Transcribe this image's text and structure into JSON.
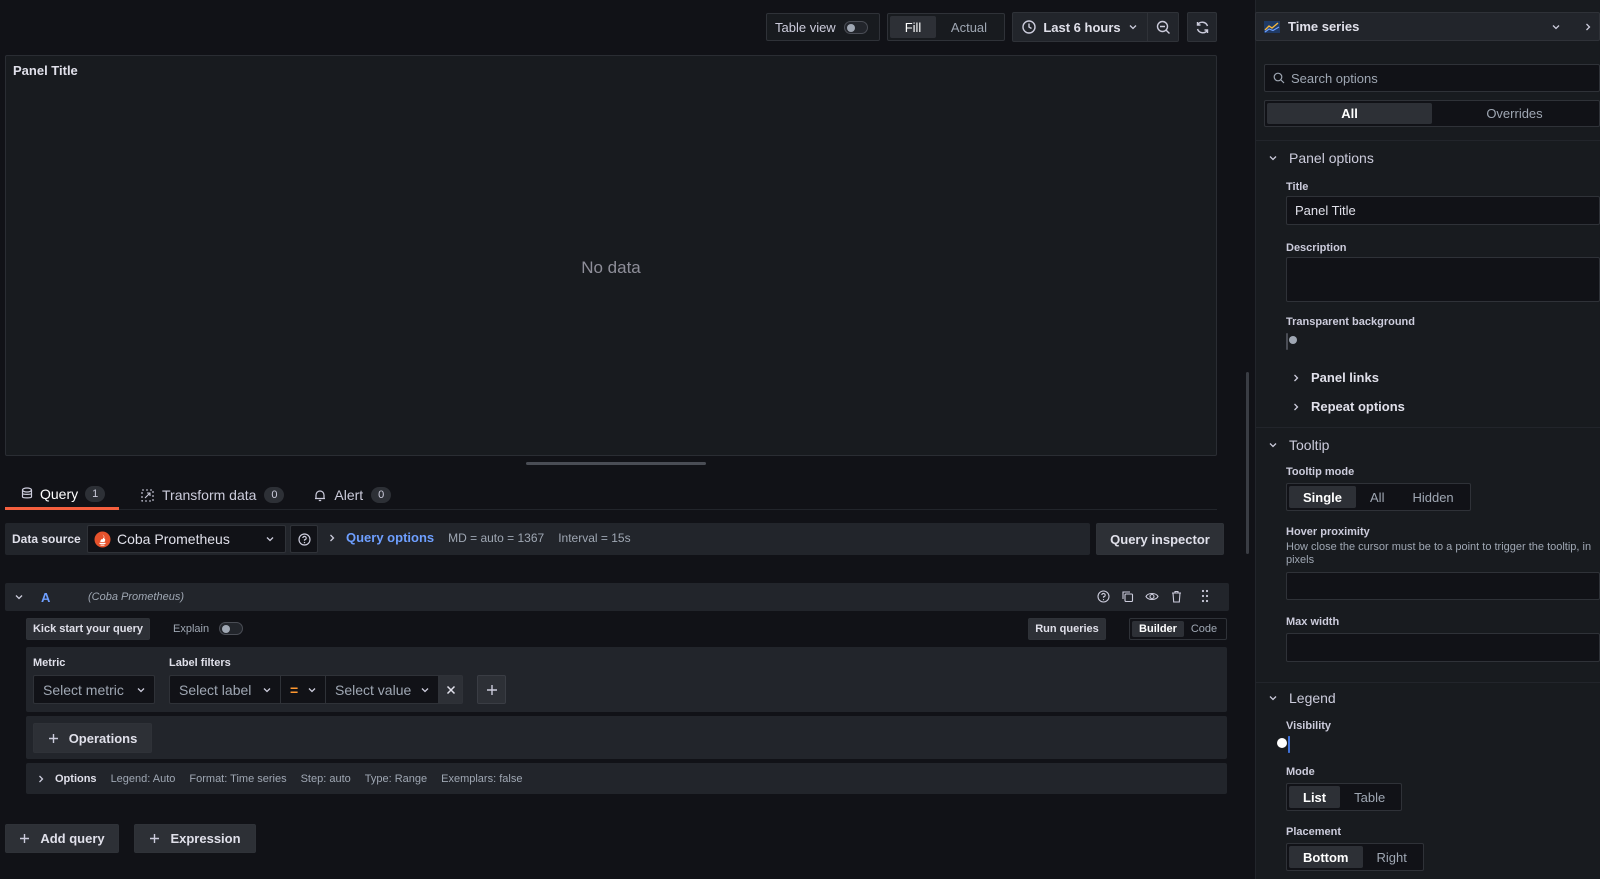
{
  "toolbar": {
    "table_view_label": "Table view",
    "fill_label": "Fill",
    "actual_label": "Actual",
    "time_range": "Last 6 hours"
  },
  "panel": {
    "title": "Panel Title",
    "no_data": "No data"
  },
  "tabs": [
    {
      "label": "Query",
      "count": "1"
    },
    {
      "label": "Transform data",
      "count": "0"
    },
    {
      "label": "Alert",
      "count": "0"
    }
  ],
  "query_bar": {
    "data_source_label": "Data source",
    "data_source_value": "Coba Prometheus",
    "query_options_label": "Query options",
    "md_info": "MD = auto = 1367",
    "interval_info": "Interval = 15s",
    "inspector_label": "Query inspector"
  },
  "query": {
    "letter": "A",
    "source": "(Coba Prometheus)",
    "kick_start": "Kick start your query",
    "explain": "Explain",
    "run_queries": "Run queries",
    "builder": "Builder",
    "code": "Code",
    "metric_label": "Metric",
    "metric_placeholder": "Select metric",
    "label_filters_label": "Label filters",
    "label_placeholder": "Select label",
    "operator": "=",
    "value_placeholder": "Select value",
    "operations": "Operations",
    "options": {
      "label": "Options",
      "legend": "Legend: Auto",
      "format": "Format: Time series",
      "step": "Step: auto",
      "type": "Type: Range",
      "exemplars": "Exemplars: false"
    }
  },
  "bottom_buttons": {
    "add_query": "Add query",
    "expression": "Expression"
  },
  "options_pane": {
    "viz_name": "Time series",
    "search_placeholder": "Search options",
    "tab_all": "All",
    "tab_overrides": "Overrides",
    "panel_options": {
      "header": "Panel options",
      "title_label": "Title",
      "title_value": "Panel Title",
      "description_label": "Description",
      "transparent_label": "Transparent background",
      "panel_links": "Panel links",
      "repeat_options": "Repeat options"
    },
    "tooltip": {
      "header": "Tooltip",
      "mode_label": "Tooltip mode",
      "modes": [
        "Single",
        "All",
        "Hidden"
      ],
      "hover_label": "Hover proximity",
      "hover_desc": "How close the cursor must be to a point to trigger the tooltip, in pixels",
      "max_width_label": "Max width"
    },
    "legend": {
      "header": "Legend",
      "visibility_label": "Visibility",
      "mode_label": "Mode",
      "modes": [
        "List",
        "Table"
      ],
      "placement_label": "Placement",
      "placements": [
        "Bottom",
        "Right"
      ]
    }
  },
  "colors": {
    "accent_blue": "#6e9fff",
    "tab_underline": "#f55f3e",
    "prometheus_red": "#e6522c",
    "operator_orange": "#ff9830"
  }
}
